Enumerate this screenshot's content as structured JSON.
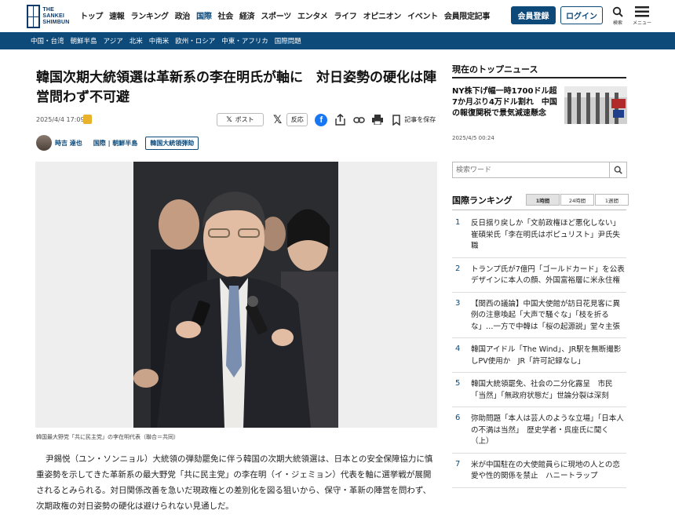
{
  "header": {
    "logo_text": "THE SANKEI SHIMBUN",
    "nav": [
      "トップ",
      "速報",
      "ランキング",
      "政治",
      "国際",
      "社会",
      "経済",
      "スポーツ",
      "エンタメ",
      "ライフ",
      "オピニオン",
      "イベント",
      "会員限定記事"
    ],
    "active_nav": "国際",
    "register_label": "会員登録",
    "login_label": "ログイン",
    "search_label": "検索",
    "menu_label": "メニュー"
  },
  "subnav": [
    "中国・台湾",
    "朝鮮半島",
    "アジア",
    "北米",
    "中南米",
    "欧州・ロシア",
    "中東・アフリカ",
    "国際問題"
  ],
  "article": {
    "title": "韓国次期大統領選は革新系の李在明氏が軸に　対日姿勢の硬化は陣営問わず不可避",
    "date": "2025/4/4 17:09",
    "share_post_label": "ポスト",
    "react_label": "反応",
    "save_label": "記事を保存",
    "author": "時吉 達也",
    "category": "国際 | 朝鮮半島",
    "tag": "韓国大統領弾劾",
    "caption": "韓国最大野党「共に民主党」の李在明代表（聯合＝共同）",
    "body": "尹錫悦（ユン・ソンニョル）大統領の弾劾罷免に伴う韓国の次期大統領選は、日本との安全保障協力に慎重姿勢を示してきた革新系の最大野党「共に民主党」の李在明（イ・ジェミョン）代表を軸に選挙戦が展開されるとみられる。対日関係改善を急いだ現政権との差別化を図る狙いから、保守・革新の陣営を問わず、次期政権の対日姿勢の硬化は避けられない見通しだ。"
  },
  "sidebar": {
    "top_news_heading": "現在のトップニュース",
    "top_news_title": "NY株下げ幅一時1700ドル超　7か月ぶり4万ドル割れ　中国の報復関税で景気減速懸念",
    "top_news_date": "2025/4/5 00:24",
    "search_placeholder": "検索ワード",
    "ranking_heading": "国際ランキング",
    "ranking_tabs": [
      "1時間",
      "24時間",
      "1週間"
    ],
    "ranking": [
      {
        "num": "1",
        "text": "反日揺り戻しか「文前政権ほど悪化しない」崔碩栄氏「李在明氏はポピュリスト」尹氏失職"
      },
      {
        "num": "2",
        "text": "トランプ氏が7億円「ゴールドカード」を公表 デザインに本人の顔、外国富裕層に米永住権"
      },
      {
        "num": "3",
        "text": "【関西の議論】中国大使館が訪日花見客に異例の注意喚起「大声で騒ぐな」「枝を折るな」…一方で中韓は「桜の起源説」堂々主張"
      },
      {
        "num": "4",
        "text": "韓国アイドル「The Wind」、JR駅を無断撮影しPV使用か　JR「許可記録なし」"
      },
      {
        "num": "5",
        "text": "韓国大統領罷免、社会の二分化露呈　市民「当然」「無政府状態だ」世論分裂は深刻"
      },
      {
        "num": "6",
        "text": "弥助問題「本人は芸人のような立場」「日本人の不満は当然」　歴史学者・呉座氏に聞く（上）"
      },
      {
        "num": "7",
        "text": "米が中国駐在の大使館員らに現地の人との恋愛や性的関係を禁止　ハニートラップ"
      }
    ]
  }
}
